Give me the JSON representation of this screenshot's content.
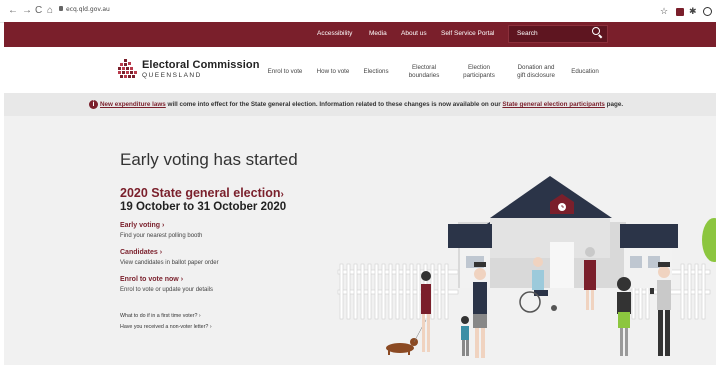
{
  "browser": {
    "url": "ecq.qld.gov.au",
    "back": "←",
    "forward": "→",
    "reload": "C",
    "home": "⌂",
    "star": "☆",
    "puzzle": "✱"
  },
  "topnav": {
    "items": [
      "Accessibility",
      "Media",
      "About us",
      "Self Service Portal"
    ],
    "search_placeholder": "Search"
  },
  "header": {
    "logo_title": "Electoral Commission",
    "logo_sub": "QUEENSLAND",
    "nav": [
      {
        "l1": "Enrol to vote",
        "l2": ""
      },
      {
        "l1": "How to vote",
        "l2": ""
      },
      {
        "l1": "Elections",
        "l2": ""
      },
      {
        "l1": "Electoral",
        "l2": "boundaries"
      },
      {
        "l1": "Election",
        "l2": "participants"
      },
      {
        "l1": "Donation and",
        "l2": "gift disclosure"
      },
      {
        "l1": "Education",
        "l2": ""
      }
    ]
  },
  "alert": {
    "icon": "i",
    "link1": "New expenditure laws",
    "text1": " will come into effect for the State general election. Information related to these changes is now available on our ",
    "link2": "State general election participants",
    "text2": " page."
  },
  "hero": {
    "title": "Early voting has started",
    "election_link": "2020 State general election",
    "chevron": "›",
    "dates": "19 October to 31 October 2020",
    "items": [
      {
        "head": "Early voting",
        "desc": "Find your nearest polling booth"
      },
      {
        "head": "Candidates",
        "desc": "View candidates in ballot paper order"
      },
      {
        "head": "Enrol to vote now",
        "desc": "Enrol to vote or update your details"
      }
    ],
    "links": [
      "What to do if in a first time voter?",
      "Have you received a non-voter letter?"
    ]
  }
}
